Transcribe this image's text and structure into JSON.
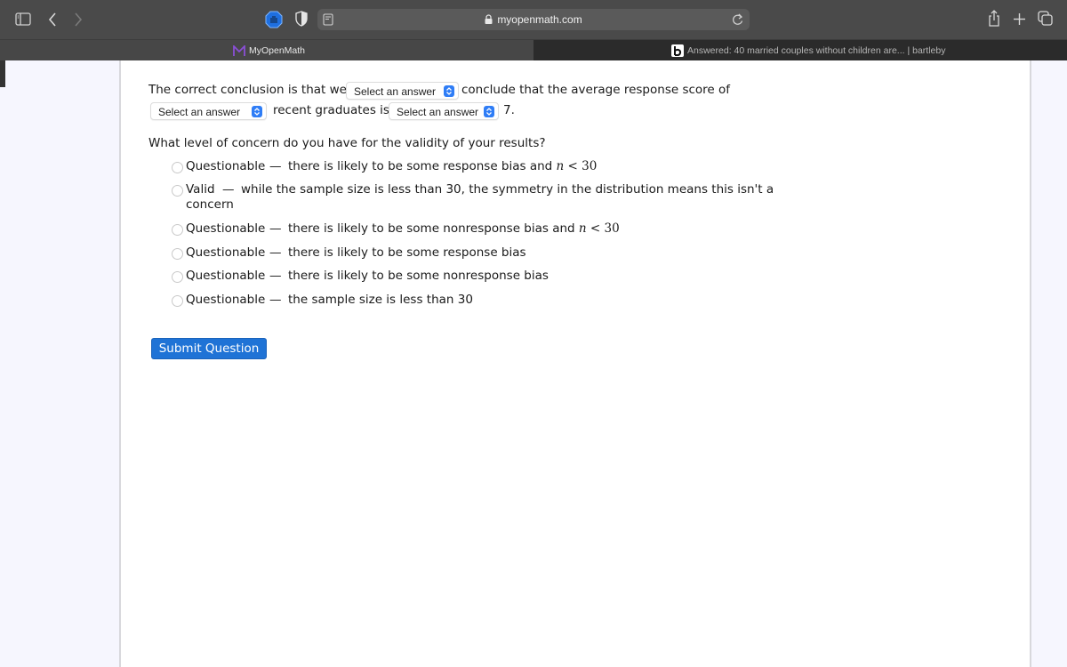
{
  "browser": {
    "url": "myopenmath.com",
    "tabs": [
      {
        "label": "MyOpenMath",
        "active": true,
        "icon": "myopenmath-logo-icon"
      },
      {
        "label": "Answered: 40 married couples without children are... | bartleby",
        "active": false,
        "icon": "bartleby-logo-icon"
      }
    ],
    "colors": {
      "accent": "#2f7df6",
      "logo_purple": "#7b3fc4"
    }
  },
  "question": {
    "sentence_part1": "The correct conclusion is that we",
    "sentence_part2": "conclude that the average response score of",
    "sentence_part3": "recent graduates is",
    "sentence_part4": "7.",
    "selects": [
      {
        "value": "Select an answer"
      },
      {
        "value": "Select an answer"
      },
      {
        "value": "Select an answer"
      }
    ],
    "concern_prompt": "What level of concern do you have for the validity of your results?",
    "options": [
      {
        "label": "Questionable",
        "dash": "—",
        "text": "there is likely to be some response bias and",
        "math_var": "n",
        "math_rest": " < 30",
        "selected": false
      },
      {
        "label": "Valid",
        "dash": "—",
        "text": "while the sample size is less than 30, the symmetry in the distribution means this isn't a",
        "text_line2": "concern",
        "selected": false
      },
      {
        "label": "Questionable",
        "dash": "—",
        "text": "there is likely to be some nonresponse bias and",
        "math_var": "n",
        "math_rest": " < 30",
        "selected": false
      },
      {
        "label": "Questionable",
        "dash": "—",
        "text": "there is likely to be some response bias",
        "selected": false
      },
      {
        "label": "Questionable",
        "dash": "—",
        "text": "there is likely to be some nonresponse bias",
        "selected": false
      },
      {
        "label": "Questionable",
        "dash": "—",
        "text": "the sample size is less than 30",
        "selected": false
      }
    ],
    "submit_label": "Submit Question"
  }
}
